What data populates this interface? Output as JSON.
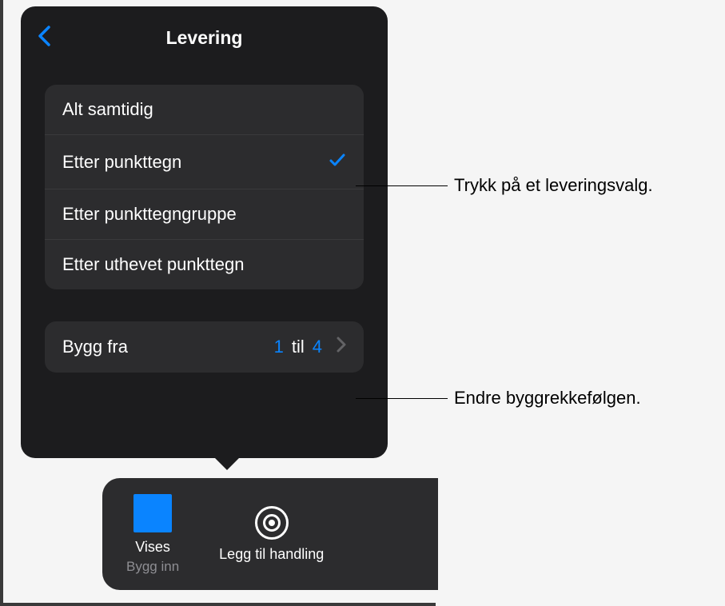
{
  "popover": {
    "title": "Levering",
    "items": [
      {
        "label": "Alt samtidig",
        "selected": false
      },
      {
        "label": "Etter punkttegn",
        "selected": true
      },
      {
        "label": "Etter punkttegngruppe",
        "selected": false
      },
      {
        "label": "Etter uthevet punkttegn",
        "selected": false
      }
    ],
    "buildFrom": {
      "label": "Bygg fra",
      "from": "1",
      "toLabel": "til",
      "to": "4"
    }
  },
  "bottomBar": {
    "item1": {
      "label": "Vises",
      "sublabel": "Bygg inn"
    },
    "item2": {
      "label": "Legg til handling"
    }
  },
  "callouts": {
    "c1": "Trykk på et leveringsvalg.",
    "c2": "Endre byggrekkefølgen."
  }
}
